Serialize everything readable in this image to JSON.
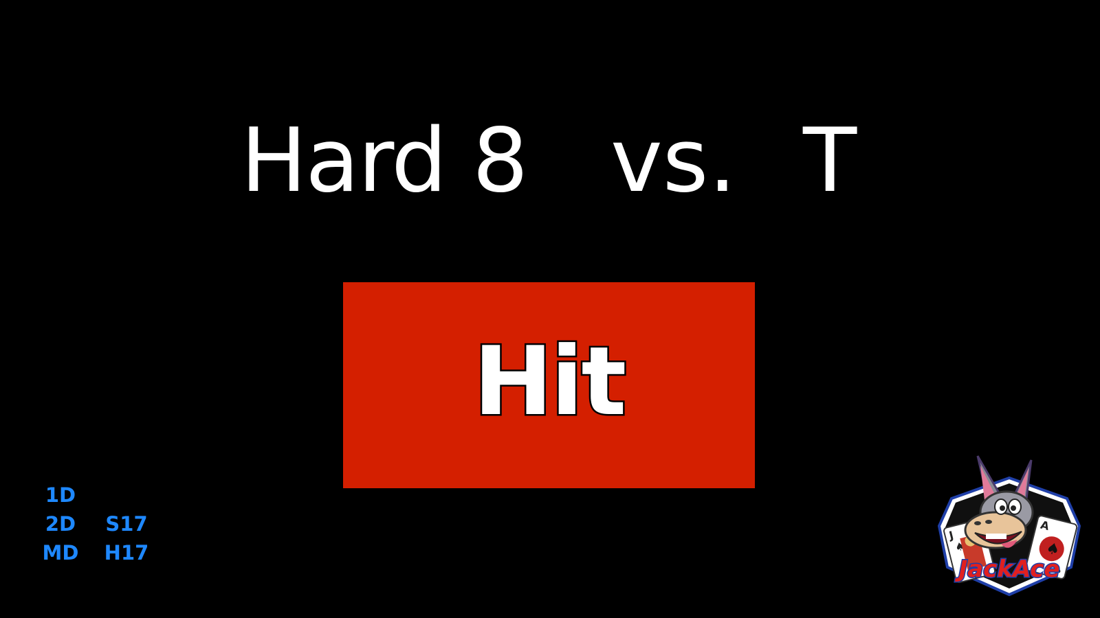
{
  "hand": {
    "player": "Hard 8",
    "versus": "vs.",
    "dealer": "T"
  },
  "action": {
    "label": "Hit",
    "color": "#d41f00"
  },
  "rules": {
    "decks": [
      "1D",
      "2D",
      "MD"
    ],
    "dealer_soft17": [
      "S17",
      "H17"
    ],
    "color": "#1e88ff"
  },
  "logo": {
    "text": "JackAce",
    "icon": "donkey-mascot-logo"
  }
}
